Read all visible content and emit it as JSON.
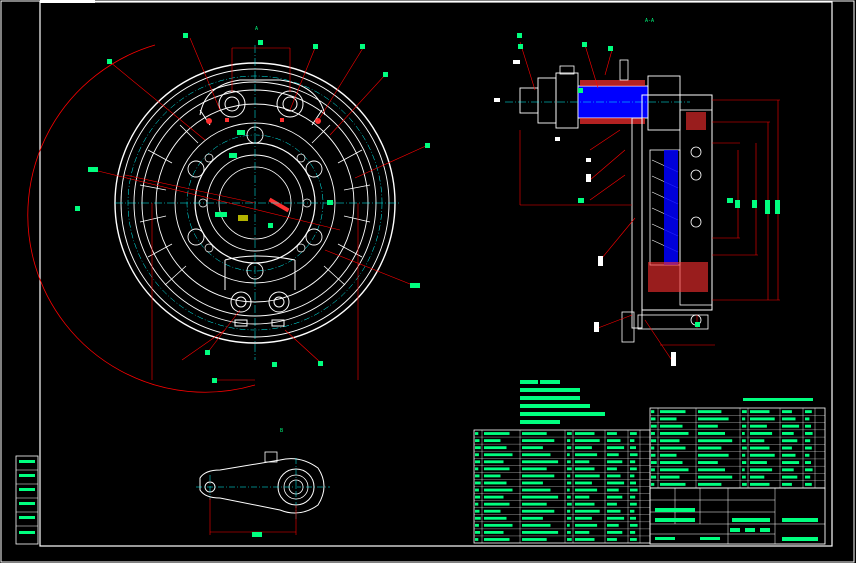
{
  "drawing": {
    "view_top_label": "A",
    "view_bottom_label": "A",
    "side_view_label": "A-A",
    "lever_view_label": "B",
    "colors": {
      "frame": "#ffffff",
      "outline": "#ffffff",
      "center": "#00ffff",
      "dimension": "#ff0000",
      "leader": "#ff0000",
      "hatch": "#0000ff",
      "section": "#ff3030",
      "tag": "#00ff7f",
      "note": "#00ff7f"
    }
  }
}
